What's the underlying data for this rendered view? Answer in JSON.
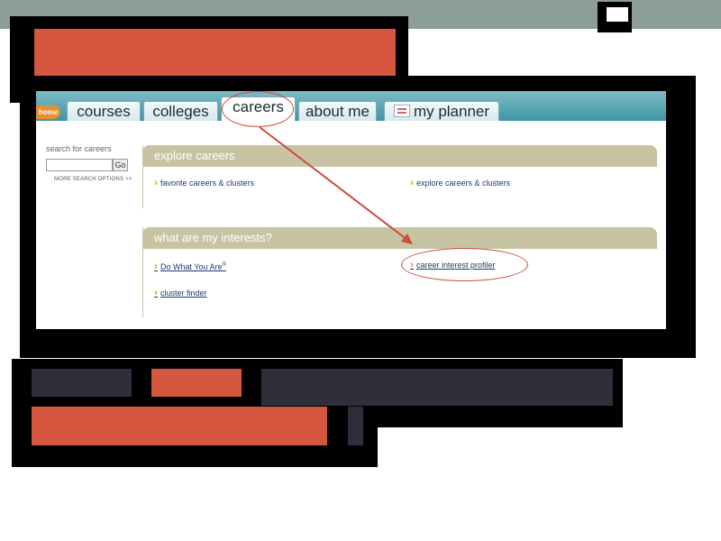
{
  "nav": {
    "home": "home",
    "tabs": [
      "courses",
      "colleges",
      "careers",
      "about me",
      "my planner"
    ],
    "active_tab": "careers"
  },
  "search": {
    "label": "search for careers",
    "go": "Go",
    "more_options": "MORE SEARCH OPTIONS >>"
  },
  "explore": {
    "heading": "explore careers",
    "links": [
      "favorite careers & clusters",
      "explore careers & clusters"
    ]
  },
  "interests": {
    "heading": "what are my interests?",
    "links": [
      "Do What You Are",
      "career interest profiler",
      "cluster finder"
    ],
    "registered_mark": "®"
  },
  "colors": {
    "accent_red": "#d6573f",
    "dark_block": "#2f2f3c",
    "header_tan": "#c8c4a3",
    "tab_teal": "#3d95a6"
  },
  "icons": [
    "home-tab-icon",
    "planner-icon",
    "chevron-bullet-icon"
  ]
}
